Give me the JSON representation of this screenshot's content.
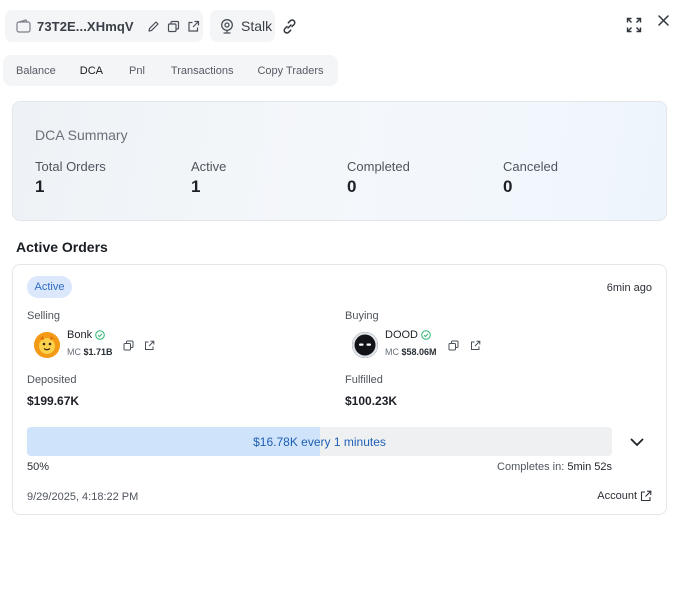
{
  "header": {
    "wallet_address": "73T2E...XHmqV",
    "stalk_label": "Stalk"
  },
  "tabs": [
    {
      "label": "Balance",
      "active": false
    },
    {
      "label": "DCA",
      "active": true
    },
    {
      "label": "Pnl",
      "active": false
    },
    {
      "label": "Transactions",
      "active": false
    },
    {
      "label": "Copy Traders",
      "active": false
    }
  ],
  "summary": {
    "title": "DCA Summary",
    "stats": [
      {
        "label": "Total Orders",
        "value": "1"
      },
      {
        "label": "Active",
        "value": "1"
      },
      {
        "label": "Completed",
        "value": "0"
      },
      {
        "label": "Canceled",
        "value": "0"
      }
    ]
  },
  "active_orders": {
    "title": "Active Orders",
    "order": {
      "status": "Active",
      "time_ago": "6min ago",
      "selling": {
        "label": "Selling",
        "token": "Bonk",
        "mc_label": "MC",
        "mc_value": "$1.71B"
      },
      "buying": {
        "label": "Buying",
        "token": "DOOD",
        "mc_label": "MC",
        "mc_value": "$58.06M"
      },
      "deposited": {
        "label": "Deposited",
        "value": "$199.67K"
      },
      "fulfilled": {
        "label": "Fulfilled",
        "value": "$100.23K"
      },
      "progress": {
        "text": "$16.78K every 1 minutes",
        "percent_label": "50%",
        "fraction": 0.5
      },
      "completes_label": "Completes in:",
      "completes_value": "5min 52s",
      "date": "9/29/2025, 4:18:22 PM",
      "account_label": "Account"
    }
  },
  "colors": {
    "accent": "#2f6cc7",
    "verified": "#2bb673",
    "progress_fill": "#cfe3fa"
  }
}
